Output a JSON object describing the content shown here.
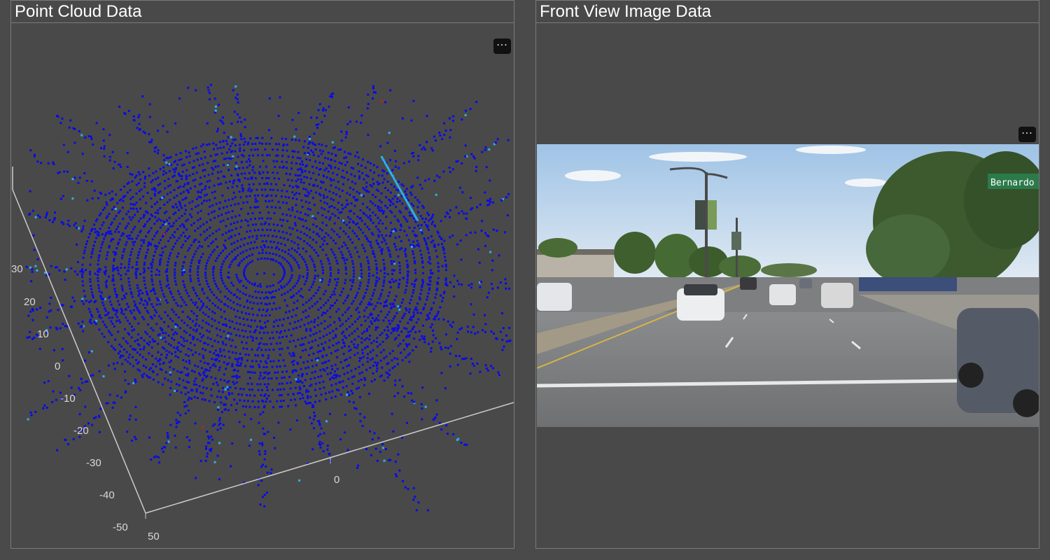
{
  "panels": {
    "point_cloud": {
      "title": "Point Cloud Data",
      "menu_label": "···",
      "axis_ticks_y": [
        "30",
        "20",
        "10",
        "0",
        "-10",
        "-20",
        "-30",
        "-40",
        "-50"
      ],
      "axis_ticks_x": [
        "50",
        "0"
      ]
    },
    "front_view": {
      "title": "Front View Image Data",
      "menu_label": "···",
      "street_sign": "Bernardo A"
    }
  },
  "colors": {
    "background": "#4a4a4a",
    "points_primary": "#0a0ae6",
    "points_secondary": "#2ab4e8",
    "points_outlier": "#c81e1e",
    "axis": "#cccccc"
  }
}
